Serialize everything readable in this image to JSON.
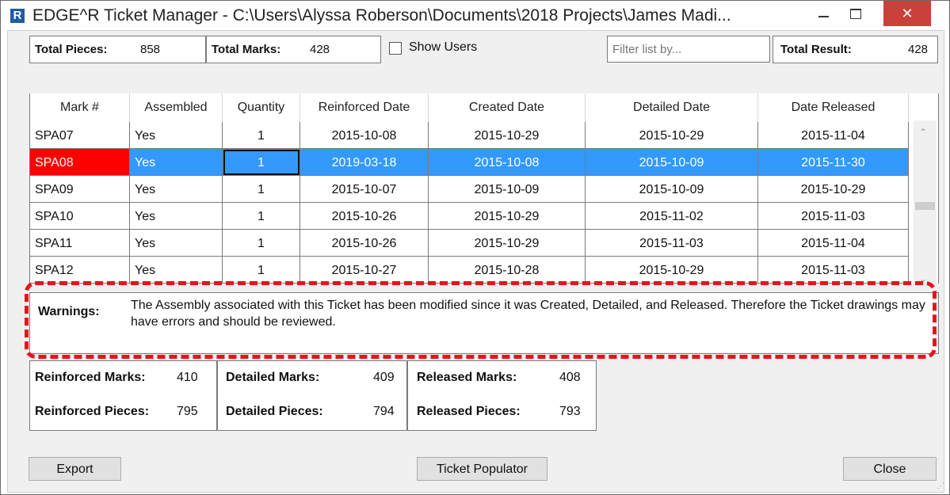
{
  "window": {
    "title": "EDGE^R Ticket Manager - C:\\Users\\Alyssa Roberson\\Documents\\2018 Projects\\James Madi...",
    "app_icon": "R",
    "close_glyph": "✕"
  },
  "summary": {
    "total_pieces_label": "Total Pieces:",
    "total_pieces_value": "858",
    "total_marks_label": "Total Marks:",
    "total_marks_value": "428",
    "show_users_label": "Show Users",
    "filter_placeholder": "Filter list by...",
    "total_result_label": "Total Result:",
    "total_result_value": "428"
  },
  "table": {
    "columns": [
      "Mark #",
      "Assembled",
      "Quantity",
      "Reinforced Date",
      "Created Date",
      "Detailed Date",
      "Date Released"
    ],
    "rows": [
      [
        "SPA07",
        "Yes",
        "1",
        "2015-10-08",
        "2015-10-29",
        "2015-10-29",
        "2015-11-04"
      ],
      [
        "SPA08",
        "Yes",
        "1",
        "2019-03-18",
        "2015-10-08",
        "2015-10-09",
        "2015-11-30"
      ],
      [
        "SPA09",
        "Yes",
        "1",
        "2015-10-07",
        "2015-10-09",
        "2015-10-09",
        "2015-10-29"
      ],
      [
        "SPA10",
        "Yes",
        "1",
        "2015-10-26",
        "2015-10-29",
        "2015-11-02",
        "2015-11-03"
      ],
      [
        "SPA11",
        "Yes",
        "1",
        "2015-10-26",
        "2015-10-29",
        "2015-11-03",
        "2015-11-04"
      ],
      [
        "SPA12",
        "Yes",
        "1",
        "2015-10-27",
        "2015-10-28",
        "2015-10-29",
        "2015-11-03"
      ]
    ],
    "selected_row": 1
  },
  "warnings": {
    "label": "Warnings:",
    "text": "The Assembly associated with this Ticket has been modified since it was Created, Detailed, and Released. Therefore the Ticket drawings may have errors and should be reviewed."
  },
  "stats": {
    "reinforced_marks_label": "Reinforced Marks:",
    "reinforced_marks_value": "410",
    "reinforced_pieces_label": "Reinforced Pieces:",
    "reinforced_pieces_value": "795",
    "detailed_marks_label": "Detailed Marks:",
    "detailed_marks_value": "409",
    "detailed_pieces_label": "Detailed Pieces:",
    "detailed_pieces_value": "794",
    "released_marks_label": "Released Marks:",
    "released_marks_value": "408",
    "released_pieces_label": "Released Pieces:",
    "released_pieces_value": "793"
  },
  "buttons": {
    "export": "Export",
    "ticket_populator": "Ticket Populator",
    "close": "Close"
  },
  "colors": {
    "selection": "#3399ff",
    "error_mark": "#ff0000",
    "highlight_dash": "#e8131b",
    "close_button": "#c9413a"
  }
}
